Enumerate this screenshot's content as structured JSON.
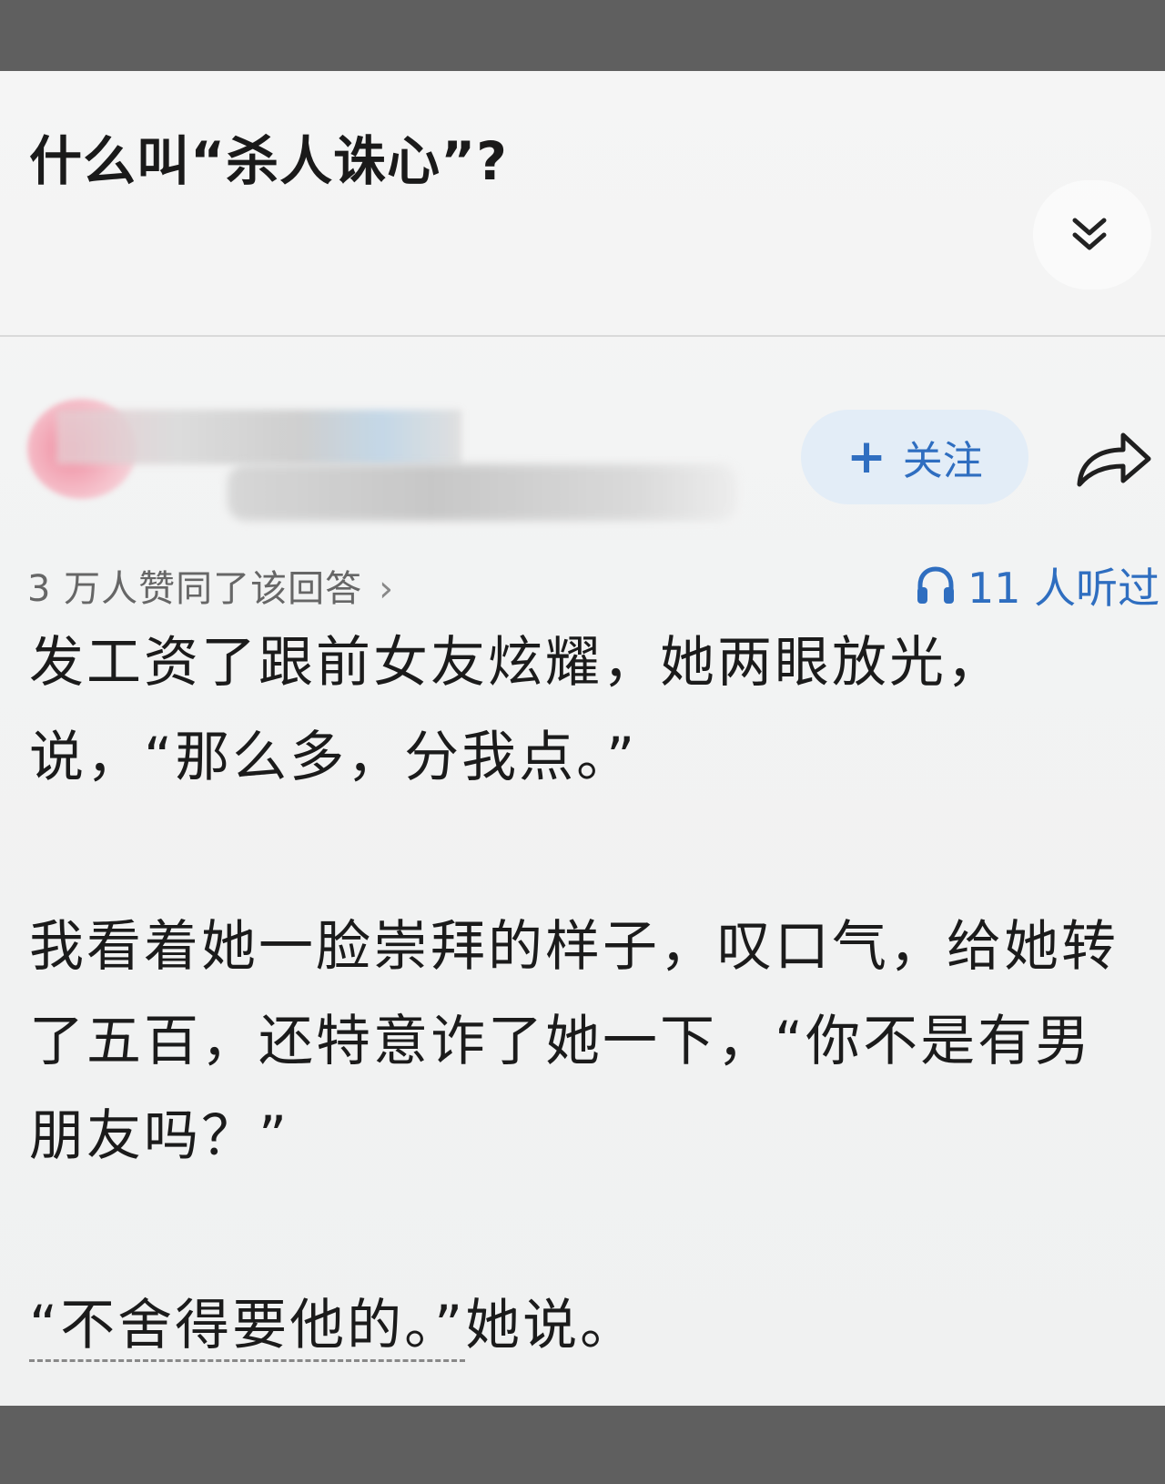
{
  "question": {
    "title": "什么叫“杀人诛心”?"
  },
  "author": {
    "follow_label": "关注",
    "follow_plus": "+"
  },
  "stats": {
    "upvotes": "3 万人赞同了该回答",
    "chevron": "›",
    "listens": "11 人听过"
  },
  "icons": {
    "expand": "double-chevron-down-icon",
    "share": "share-arrow-icon",
    "listen": "headphones-icon"
  },
  "colors": {
    "accent": "#2f6ec0",
    "follow_bg": "#e3edf7"
  },
  "answer": {
    "p1": "发工资了跟前女友炫耀，她两眼放光，说，“那么多，分我点。”",
    "p2": "我看着她一脸崇拜的样子，叹口气，给她转了五百，还特意诈了她一下，“你不是有男朋友吗？”",
    "p3_quote": "“不舍得要他的。”",
    "p3_tail": "她说。"
  }
}
